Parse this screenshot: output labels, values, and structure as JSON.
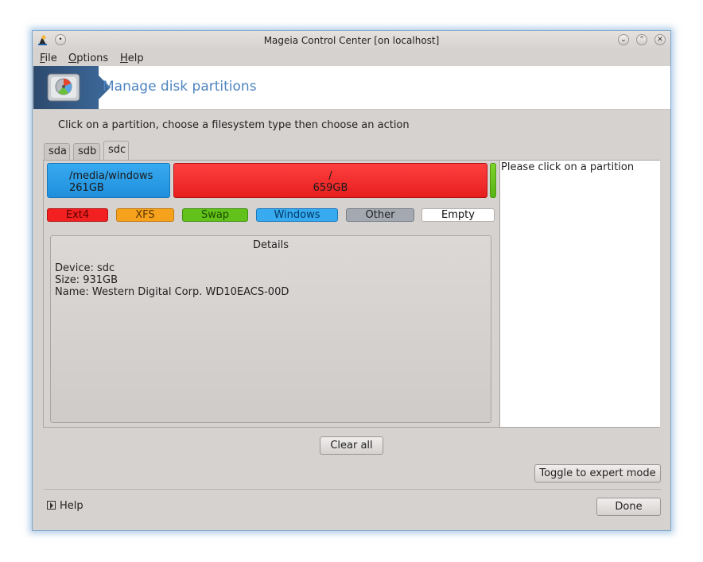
{
  "window": {
    "title": "Mageia Control Center  [on localhost]"
  },
  "menubar": {
    "items": [
      {
        "accel": "F",
        "rest": "ile"
      },
      {
        "accel": "O",
        "rest": "ptions"
      },
      {
        "accel": "H",
        "rest": "elp"
      }
    ]
  },
  "banner": {
    "title": "Manage disk partitions",
    "icon": "hard-disk-icon"
  },
  "instructions": "Click on a partition, choose a filesystem type then choose an action",
  "tabs": [
    "sda",
    "sdb",
    "sdc"
  ],
  "active_tab": "sdc",
  "partitions": [
    {
      "mount": "/media/windows",
      "size": "261GB",
      "color": "#2aa0ea"
    },
    {
      "mount": "/",
      "size": "659GB",
      "color": "#f22a2a"
    },
    {
      "mount": "",
      "size": "",
      "color": "#6cc51b"
    }
  ],
  "legend": [
    {
      "label": "Ext4",
      "color": "#f22020"
    },
    {
      "label": "XFS",
      "color": "#f7a21d"
    },
    {
      "label": "Swap",
      "color": "#62c11a"
    },
    {
      "label": "Windows",
      "color": "#38aaf0"
    },
    {
      "label": "Other",
      "color": "#a3a8b1"
    },
    {
      "label": "Empty",
      "color": "#ffffff"
    }
  ],
  "details": {
    "title": "Details",
    "lines": [
      "Device: sdc",
      "Size: 931GB",
      "Name: Western Digital Corp. WD10EACS-00D"
    ]
  },
  "info_panel": {
    "text": "Please click on a partition"
  },
  "buttons": {
    "clear_all": "Clear all",
    "toggle_expert": "Toggle to expert mode",
    "help": "Help",
    "done": "Done"
  }
}
